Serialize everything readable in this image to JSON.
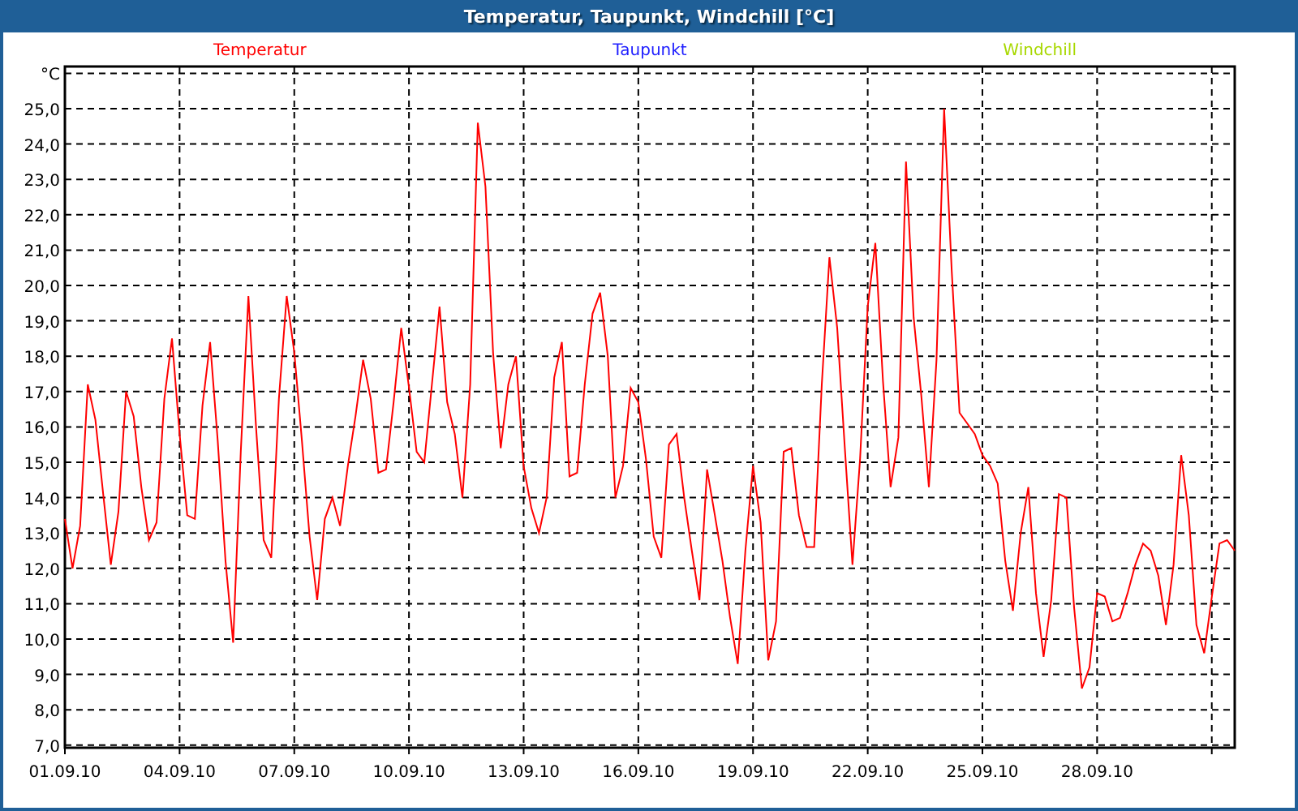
{
  "window": {
    "title": "Temperatur, Taupunkt, Windchill [°C]"
  },
  "chart": {
    "chart_data": {
      "type": "line",
      "grid": true,
      "ylim": [
        7,
        26
      ],
      "yticks": [
        {
          "value": 7,
          "label": "7,0"
        },
        {
          "value": 8,
          "label": "8,0"
        },
        {
          "value": 9,
          "label": "9,0"
        },
        {
          "value": 10,
          "label": "10,0"
        },
        {
          "value": 11,
          "label": "11,0"
        },
        {
          "value": 12,
          "label": "12,0"
        },
        {
          "value": 13,
          "label": "13,0"
        },
        {
          "value": 14,
          "label": "14,0"
        },
        {
          "value": 15,
          "label": "15,0"
        },
        {
          "value": 16,
          "label": "16,0"
        },
        {
          "value": 17,
          "label": "17,0"
        },
        {
          "value": 18,
          "label": "18,0"
        },
        {
          "value": 19,
          "label": "19,0"
        },
        {
          "value": 20,
          "label": "20,0"
        },
        {
          "value": 21,
          "label": "21,0"
        },
        {
          "value": 22,
          "label": "22,0"
        },
        {
          "value": 23,
          "label": "23,0"
        },
        {
          "value": 24,
          "label": "24,0"
        },
        {
          "value": 25,
          "label": "25,0"
        },
        {
          "value": 26,
          "label": "°C"
        }
      ],
      "categories": [
        "01.09.10",
        null,
        null,
        null,
        null,
        null,
        null,
        null,
        null,
        null,
        null,
        null,
        null,
        null,
        null,
        "04.09.10",
        null,
        null,
        null,
        null,
        null,
        null,
        null,
        null,
        null,
        null,
        null,
        null,
        null,
        null,
        "07.09.10",
        null,
        null,
        null,
        null,
        null,
        null,
        null,
        null,
        null,
        null,
        null,
        null,
        null,
        null,
        "10.09.10",
        null,
        null,
        null,
        null,
        null,
        null,
        null,
        null,
        null,
        null,
        null,
        null,
        null,
        null,
        "13.09.10",
        null,
        null,
        null,
        null,
        null,
        null,
        null,
        null,
        null,
        null,
        null,
        null,
        null,
        null,
        "16.09.10",
        null,
        null,
        null,
        null,
        null,
        null,
        null,
        null,
        null,
        null,
        null,
        null,
        null,
        null,
        "19.09.10",
        null,
        null,
        null,
        null,
        null,
        null,
        null,
        null,
        null,
        null,
        null,
        null,
        null,
        null,
        "22.09.10",
        null,
        null,
        null,
        null,
        null,
        null,
        null,
        null,
        null,
        null,
        null,
        null,
        null,
        null,
        "25.09.10",
        null,
        null,
        null,
        null,
        null,
        null,
        null,
        null,
        null,
        null,
        null,
        null,
        null,
        null,
        "28.09.10",
        null,
        null,
        null,
        null,
        null,
        null,
        null,
        null,
        null,
        null,
        null,
        null,
        null,
        null,
        null,
        null,
        null,
        null
      ],
      "series": [
        {
          "name": "Temperatur",
          "color": "#ff0000",
          "values": [
            13.4,
            12.0,
            13.2,
            17.2,
            16.2,
            14.1,
            12.1,
            13.6,
            17.0,
            16.3,
            14.3,
            12.8,
            13.3,
            16.8,
            18.5,
            15.8,
            13.5,
            13.4,
            16.6,
            18.4,
            15.6,
            12.2,
            9.9,
            15.3,
            19.7,
            16.0,
            12.8,
            12.3,
            16.8,
            19.7,
            18.1,
            15.6,
            12.9,
            11.1,
            13.4,
            14.0,
            13.2,
            14.9,
            16.3,
            17.9,
            16.8,
            14.7,
            14.8,
            16.7,
            18.8,
            17.1,
            15.3,
            15.0,
            17.2,
            19.4,
            16.7,
            15.8,
            14.0,
            17.2,
            24.6,
            22.8,
            18.1,
            15.4,
            17.2,
            18.0,
            14.9,
            13.7,
            13.0,
            14.0,
            17.4,
            18.4,
            14.6,
            14.7,
            17.2,
            19.2,
            19.8,
            18.0,
            14.0,
            14.9,
            17.1,
            16.7,
            15.1,
            12.9,
            12.3,
            15.5,
            15.8,
            14.0,
            12.5,
            11.1,
            14.8,
            13.5,
            12.2,
            10.6,
            9.3,
            12.5,
            14.9,
            13.3,
            9.4,
            10.5,
            15.3,
            15.4,
            13.5,
            12.6,
            12.6,
            17.2,
            20.8,
            18.8,
            15.4,
            12.1,
            15.1,
            19.4,
            21.2,
            17.3,
            14.3,
            15.7,
            23.5,
            19.1,
            16.9,
            14.3,
            17.9,
            25.0,
            20.4,
            16.4,
            16.1,
            15.8,
            15.2,
            14.9,
            14.4,
            12.2,
            10.8,
            13.0,
            14.3,
            11.3,
            9.5,
            11.1,
            14.1,
            14.0,
            10.9,
            8.6,
            9.2,
            11.3,
            11.2,
            10.5,
            10.6,
            11.3,
            12.1,
            12.7,
            12.5,
            11.8,
            10.4,
            12.1,
            15.2,
            13.5,
            10.4,
            9.6,
            11.2,
            12.7,
            12.8,
            12.5
          ]
        },
        {
          "name": "Taupunkt",
          "color": "#2020ff",
          "values": [
            null,
            null,
            null,
            null,
            null,
            null,
            null,
            null,
            null,
            null,
            null,
            null,
            null,
            null,
            null,
            null,
            null,
            null,
            null,
            null,
            null,
            null,
            null,
            null,
            null,
            null,
            null,
            null,
            null,
            null,
            null,
            null,
            null,
            null,
            null,
            null,
            null,
            null,
            null,
            null,
            null,
            null,
            null,
            null,
            null,
            null,
            null,
            null,
            null,
            null,
            null,
            null,
            null,
            null,
            null,
            null,
            null,
            null,
            null,
            null,
            null,
            null,
            null,
            null,
            null,
            null,
            null,
            null,
            null,
            null,
            null,
            null,
            null,
            null,
            null,
            null,
            null,
            null,
            null,
            null,
            null,
            null,
            null,
            null,
            null,
            null,
            null,
            null,
            null,
            null,
            null,
            null,
            null,
            null,
            null,
            null,
            null,
            null,
            null,
            null,
            null,
            null,
            null,
            null,
            null,
            null,
            null,
            null,
            null,
            null,
            null,
            null,
            null,
            null,
            null,
            null,
            null,
            null,
            null,
            null,
            null,
            null,
            null,
            null,
            null,
            null,
            null,
            null,
            null,
            null,
            null,
            null,
            null,
            null,
            null,
            null,
            null,
            null,
            null,
            null,
            null,
            null,
            null,
            null,
            null,
            null,
            null,
            null,
            null,
            null,
            null,
            null,
            null,
            null
          ]
        },
        {
          "name": "Windchill",
          "color": "#a8d800",
          "values": [
            null,
            null,
            null,
            null,
            null,
            null,
            null,
            null,
            null,
            null,
            null,
            null,
            null,
            null,
            null,
            null,
            null,
            null,
            null,
            null,
            null,
            null,
            null,
            null,
            null,
            null,
            null,
            null,
            null,
            null,
            null,
            null,
            null,
            null,
            null,
            null,
            null,
            null,
            null,
            null,
            null,
            null,
            null,
            null,
            null,
            null,
            null,
            null,
            null,
            null,
            null,
            null,
            null,
            null,
            null,
            null,
            null,
            null,
            null,
            null,
            null,
            null,
            null,
            null,
            null,
            null,
            null,
            null,
            null,
            null,
            null,
            null,
            null,
            null,
            null,
            null,
            null,
            null,
            null,
            null,
            null,
            null,
            null,
            null,
            null,
            null,
            null,
            null,
            null,
            null,
            null,
            null,
            null,
            null,
            null,
            null,
            null,
            null,
            null,
            null,
            null,
            null,
            null,
            null,
            null,
            null,
            null,
            null,
            null,
            null,
            null,
            null,
            null,
            null,
            null,
            null,
            null,
            null,
            null,
            null,
            null,
            null,
            null,
            null,
            null,
            null,
            null,
            null,
            null,
            null,
            null,
            null,
            null,
            null,
            null,
            null,
            null,
            null,
            null,
            null,
            null,
            null,
            null,
            null,
            null,
            null,
            null,
            null,
            null,
            null,
            null,
            null,
            null,
            null
          ]
        }
      ]
    }
  }
}
